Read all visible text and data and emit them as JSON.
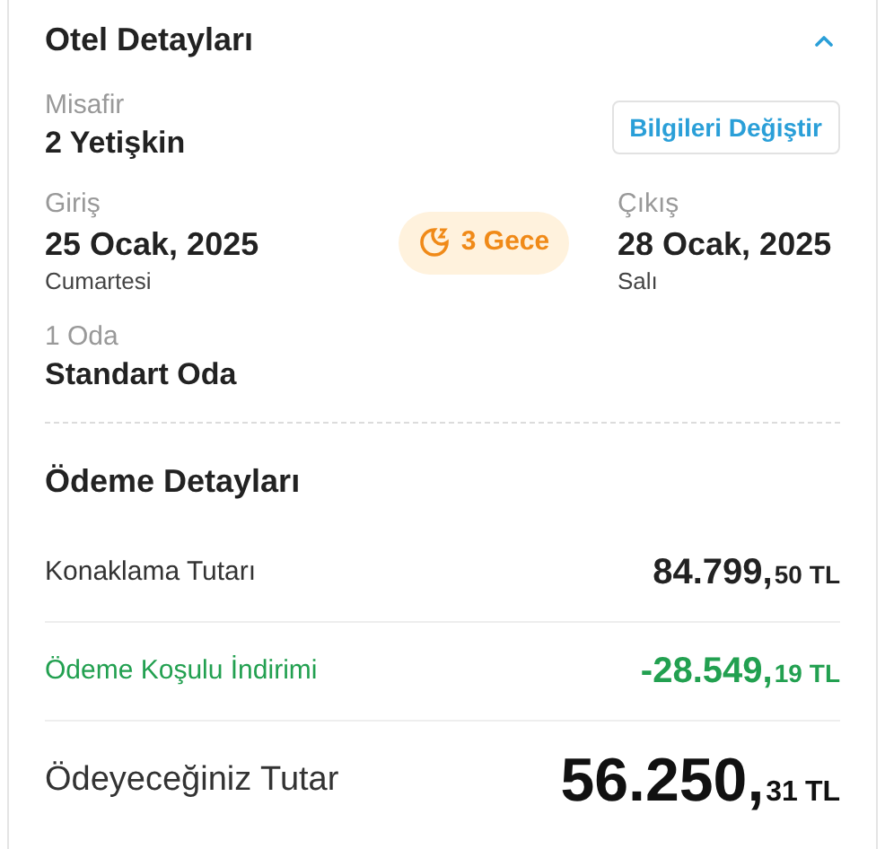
{
  "hotel": {
    "title": "Otel Detayları",
    "expanded": true,
    "guest": {
      "label": "Misafir",
      "value": "2 Yetişkin"
    },
    "change_button": "Bilgileri Değiştir",
    "checkin": {
      "label": "Giriş",
      "date": "25 Ocak, 2025",
      "day": "Cumartesi"
    },
    "nights": "3 Gece",
    "checkout": {
      "label": "Çıkış",
      "date": "28 Ocak, 2025",
      "day": "Salı"
    },
    "room": {
      "label": "1 Oda",
      "value": "Standart Oda"
    }
  },
  "payment": {
    "title": "Ödeme Detayları",
    "rows": [
      {
        "kind": "normal",
        "label": "Konaklama Tutarı",
        "amount": "84.799,",
        "decimals": "50",
        "currency": "TL"
      },
      {
        "kind": "discount",
        "label": "Ödeme Koşulu İndirimi",
        "amount": "-28.549,",
        "decimals": "19",
        "currency": "TL"
      },
      {
        "kind": "total",
        "label": "Ödeyeceğiniz Tutar",
        "amount": "56.250,",
        "decimals": "31",
        "currency": "TL"
      }
    ]
  }
}
